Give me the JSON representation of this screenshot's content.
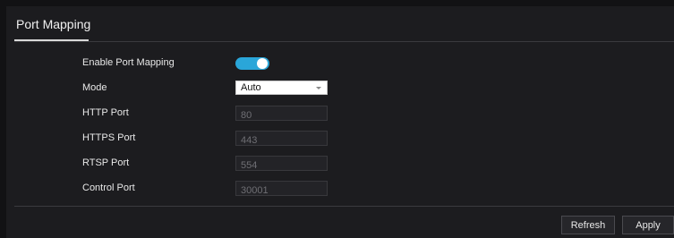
{
  "header": {
    "title": "Port Mapping"
  },
  "form": {
    "enable": {
      "label": "Enable Port Mapping",
      "value": true
    },
    "mode": {
      "label": "Mode",
      "value": "Auto"
    },
    "http_port": {
      "label": "HTTP Port",
      "value": "80"
    },
    "https_port": {
      "label": "HTTPS Port",
      "value": "443"
    },
    "rtsp_port": {
      "label": "RTSP Port",
      "value": "554"
    },
    "control_port": {
      "label": "Control Port",
      "value": "30001"
    }
  },
  "buttons": {
    "refresh": "Refresh",
    "apply": "Apply"
  },
  "colors": {
    "accent": "#2aa6d9",
    "background": "#1c1c1f",
    "page": "#121214"
  }
}
